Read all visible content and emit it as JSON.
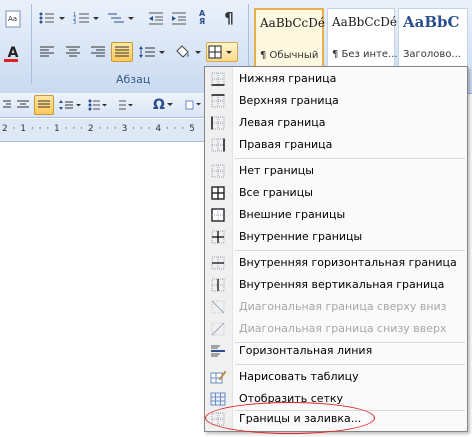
{
  "ribbon": {
    "group_label": "Абзац",
    "font_color_letter": "A",
    "sort_letters": "АЯ",
    "pilcrow": "¶",
    "styles": [
      {
        "sample": "AaBbCcDé",
        "name": "¶ Обычный"
      },
      {
        "sample": "AaBbCcDé",
        "name": "¶ Без инте..."
      },
      {
        "sample": "AaBbC",
        "name": "Заголово..."
      }
    ]
  },
  "toolbar2": {
    "omega": "Ω"
  },
  "ruler": {
    "text": "2 · 1 · · · 1 · · · 2 · · · 3 · · · 4 · · · 5"
  },
  "menu": {
    "items": [
      {
        "id": "bottom",
        "label": "Нижняя граница",
        "icon": "border-bottom-icon",
        "disabled": false
      },
      {
        "id": "top",
        "label": "Верхняя граница",
        "icon": "border-top-icon",
        "disabled": false
      },
      {
        "id": "left",
        "label": "Левая граница",
        "icon": "border-left-icon",
        "disabled": false
      },
      {
        "id": "right",
        "label": "Правая граница",
        "icon": "border-right-icon",
        "disabled": false
      },
      {
        "id": "none",
        "label": "Нет границы",
        "icon": "border-none-icon",
        "disabled": false
      },
      {
        "id": "all",
        "label": "Все границы",
        "icon": "border-all-icon",
        "disabled": false
      },
      {
        "id": "outside",
        "label": "Внешние границы",
        "icon": "border-outside-icon",
        "disabled": false
      },
      {
        "id": "inside",
        "label": "Внутренние границы",
        "icon": "border-inside-icon",
        "disabled": false
      },
      {
        "id": "inside-h",
        "label": "Внутренняя горизонтальная граница",
        "icon": "border-inside-horizontal-icon",
        "disabled": false
      },
      {
        "id": "inside-v",
        "label": "Внутренняя вертикальная граница",
        "icon": "border-inside-vertical-icon",
        "disabled": false
      },
      {
        "id": "diag-down",
        "label": "Диагональная граница сверху вниз",
        "icon": "diagonal-down-border-icon",
        "disabled": true
      },
      {
        "id": "diag-up",
        "label": "Диагональная граница снизу вверх",
        "icon": "diagonal-up-border-icon",
        "disabled": true
      },
      {
        "id": "hline",
        "label": "Горизонтальная линия",
        "icon": "horizontal-line-icon",
        "disabled": false
      },
      {
        "id": "draw",
        "label": "Нарисовать таблицу",
        "icon": "draw-table-icon",
        "disabled": false
      },
      {
        "id": "grid",
        "label": "Отобразить сетку",
        "icon": "view-gridlines-icon",
        "disabled": false
      },
      {
        "id": "shading",
        "label": "Границы и заливка...",
        "icon": "borders-and-shading-icon",
        "disabled": false
      }
    ]
  },
  "colors": {
    "annotation": "#e02020",
    "accent": "#ffc75a"
  }
}
